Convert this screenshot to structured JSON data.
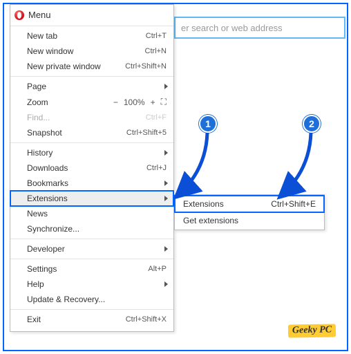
{
  "frame": {
    "accent": "#0066ff"
  },
  "address": {
    "placeholder": "er search or web address"
  },
  "header": {
    "label": "Menu"
  },
  "menu": {
    "newtab": {
      "label": "New tab",
      "shortcut": "Ctrl+T"
    },
    "newwindow": {
      "label": "New window",
      "shortcut": "Ctrl+N"
    },
    "newprivate": {
      "label": "New private window",
      "shortcut": "Ctrl+Shift+N"
    },
    "page": {
      "label": "Page"
    },
    "zoom": {
      "label": "Zoom",
      "minus": "−",
      "percent": "100%",
      "plus": "+",
      "full": "⛶"
    },
    "find": {
      "label": "Find...",
      "shortcut": "Ctrl+F"
    },
    "snapshot": {
      "label": "Snapshot",
      "shortcut": "Ctrl+Shift+5"
    },
    "history": {
      "label": "History"
    },
    "downloads": {
      "label": "Downloads",
      "shortcut": "Ctrl+J"
    },
    "bookmarks": {
      "label": "Bookmarks"
    },
    "extensions": {
      "label": "Extensions"
    },
    "news": {
      "label": "News"
    },
    "sync": {
      "label": "Synchronize..."
    },
    "developer": {
      "label": "Developer"
    },
    "settings": {
      "label": "Settings",
      "shortcut": "Alt+P"
    },
    "help": {
      "label": "Help"
    },
    "update": {
      "label": "Update & Recovery..."
    },
    "exit": {
      "label": "Exit",
      "shortcut": "Ctrl+Shift+X"
    }
  },
  "submenu": {
    "extensions": {
      "label": "Extensions",
      "shortcut": "Ctrl+Shift+E"
    },
    "getextensions": {
      "label": "Get extensions"
    }
  },
  "callouts": {
    "one": "1",
    "two": "2"
  },
  "watermark": {
    "text": "Geeky PC"
  }
}
